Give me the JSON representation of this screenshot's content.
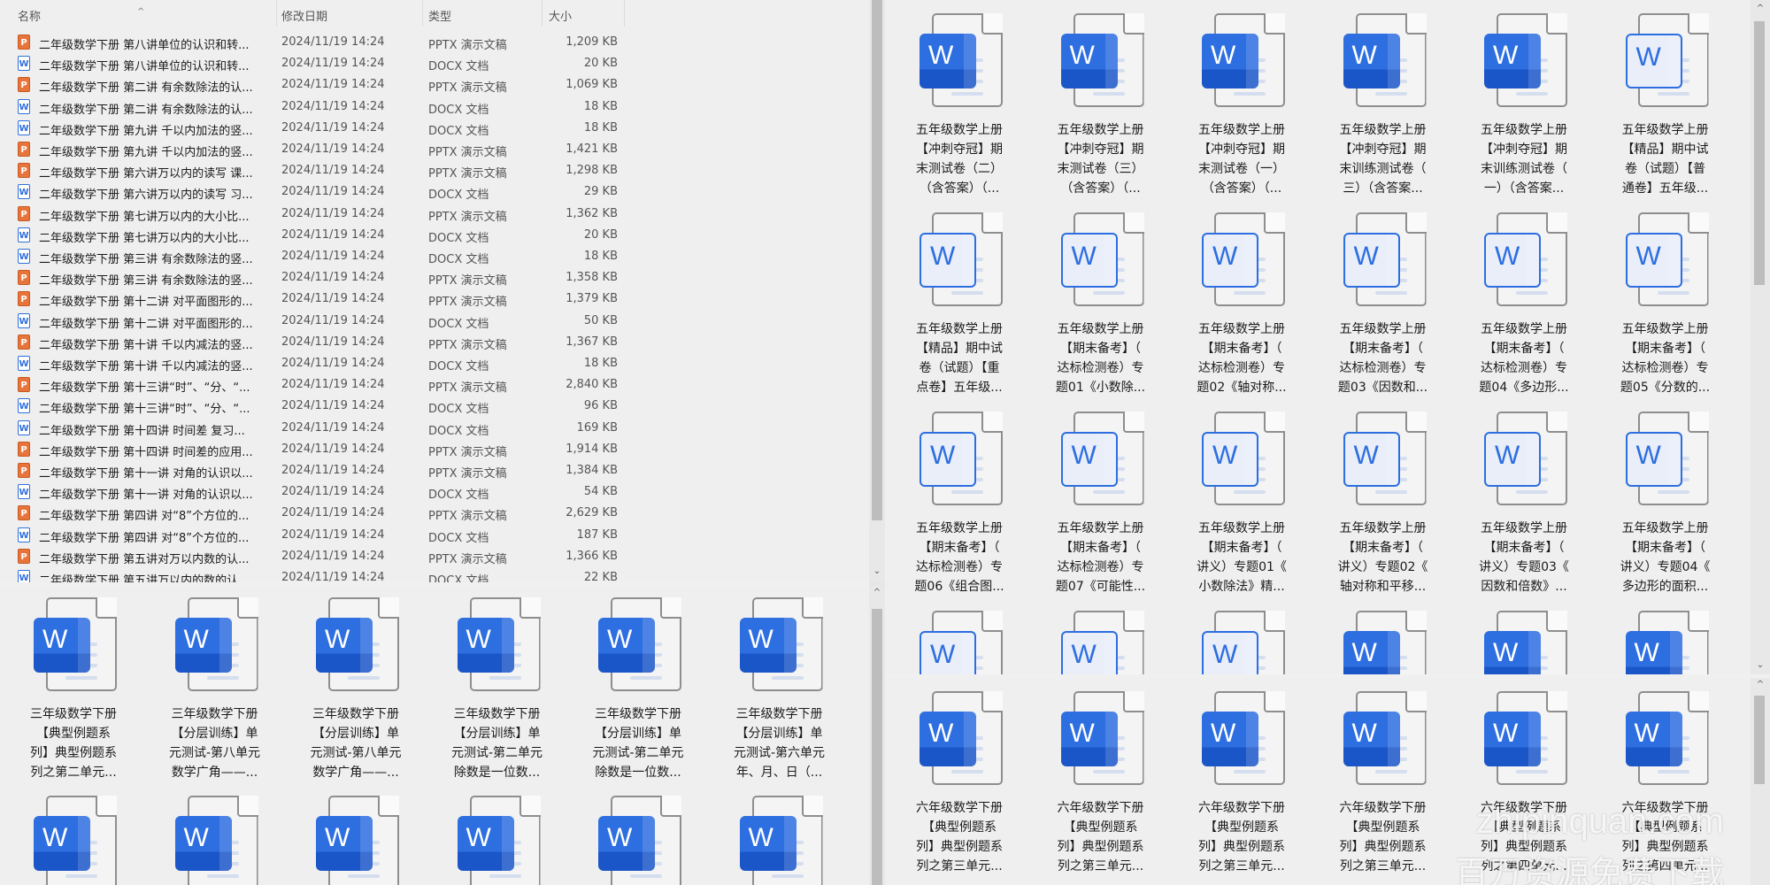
{
  "left_list": {
    "headers": {
      "name": "名称",
      "date": "修改日期",
      "type": "类型",
      "size": "大小"
    },
    "rows": [
      {
        "icon": "pptx",
        "name": "二年级数学下册  第八讲单位的认识和转...",
        "date": "2024/11/19 14:24",
        "type": "PPTX 演示文稿",
        "size": "1,209 KB"
      },
      {
        "icon": "docx",
        "name": "二年级数学下册  第八讲单位的认识和转...",
        "date": "2024/11/19 14:24",
        "type": "DOCX 文档",
        "size": "20 KB"
      },
      {
        "icon": "pptx",
        "name": "二年级数学下册  第二讲 有余数除法的认...",
        "date": "2024/11/19 14:24",
        "type": "PPTX 演示文稿",
        "size": "1,069 KB"
      },
      {
        "icon": "docx",
        "name": "二年级数学下册  第二讲 有余数除法的认...",
        "date": "2024/11/19 14:24",
        "type": "DOCX 文档",
        "size": "18 KB"
      },
      {
        "icon": "docx",
        "name": "二年级数学下册  第九讲 千以内加法的竖...",
        "date": "2024/11/19 14:24",
        "type": "DOCX 文档",
        "size": "18 KB"
      },
      {
        "icon": "pptx",
        "name": "二年级数学下册  第九讲 千以内加法的竖...",
        "date": "2024/11/19 14:24",
        "type": "PPTX 演示文稿",
        "size": "1,421 KB"
      },
      {
        "icon": "pptx",
        "name": "二年级数学下册  第六讲万以内的读写 课...",
        "date": "2024/11/19 14:24",
        "type": "PPTX 演示文稿",
        "size": "1,298 KB"
      },
      {
        "icon": "docx",
        "name": "二年级数学下册  第六讲万以内的读写 习...",
        "date": "2024/11/19 14:24",
        "type": "DOCX 文档",
        "size": "29 KB"
      },
      {
        "icon": "pptx",
        "name": "二年级数学下册  第七讲万以内的大小比...",
        "date": "2024/11/19 14:24",
        "type": "PPTX 演示文稿",
        "size": "1,362 KB"
      },
      {
        "icon": "docx",
        "name": "二年级数学下册  第七讲万以内的大小比...",
        "date": "2024/11/19 14:24",
        "type": "DOCX 文档",
        "size": "20 KB"
      },
      {
        "icon": "docx",
        "name": "二年级数学下册  第三讲 有余数除法的竖...",
        "date": "2024/11/19 14:24",
        "type": "DOCX 文档",
        "size": "18 KB"
      },
      {
        "icon": "pptx",
        "name": "二年级数学下册  第三讲 有余数除法的竖...",
        "date": "2024/11/19 14:24",
        "type": "PPTX 演示文稿",
        "size": "1,358 KB"
      },
      {
        "icon": "pptx",
        "name": "二年级数学下册  第十二讲 对平面图形的...",
        "date": "2024/11/19 14:24",
        "type": "PPTX 演示文稿",
        "size": "1,379 KB"
      },
      {
        "icon": "docx",
        "name": "二年级数学下册  第十二讲 对平面图形的...",
        "date": "2024/11/19 14:24",
        "type": "DOCX 文档",
        "size": "50 KB"
      },
      {
        "icon": "pptx",
        "name": "二年级数学下册  第十讲 千以内减法的竖...",
        "date": "2024/11/19 14:24",
        "type": "PPTX 演示文稿",
        "size": "1,367 KB"
      },
      {
        "icon": "docx",
        "name": "二年级数学下册  第十讲 千以内减法的竖...",
        "date": "2024/11/19 14:24",
        "type": "DOCX 文档",
        "size": "18 KB"
      },
      {
        "icon": "pptx",
        "name": "二年级数学下册  第十三讲“时”、“分、“...",
        "date": "2024/11/19 14:24",
        "type": "PPTX 演示文稿",
        "size": "2,840 KB"
      },
      {
        "icon": "docx",
        "name": "二年级数学下册  第十三讲“时”、“分、“...",
        "date": "2024/11/19 14:24",
        "type": "DOCX 文档",
        "size": "96 KB"
      },
      {
        "icon": "docx",
        "name": "二年级数学下册  第十四讲 时间差 复习...",
        "date": "2024/11/19 14:24",
        "type": "DOCX 文档",
        "size": "169 KB"
      },
      {
        "icon": "pptx",
        "name": "二年级数学下册  第十四讲 时间差的应用...",
        "date": "2024/11/19 14:24",
        "type": "PPTX 演示文稿",
        "size": "1,914 KB"
      },
      {
        "icon": "pptx",
        "name": "二年级数学下册  第十一讲 对角的认识以...",
        "date": "2024/11/19 14:24",
        "type": "PPTX 演示文稿",
        "size": "1,384 KB"
      },
      {
        "icon": "docx",
        "name": "二年级数学下册  第十一讲 对角的认识以...",
        "date": "2024/11/19 14:24",
        "type": "DOCX 文档",
        "size": "54 KB"
      },
      {
        "icon": "pptx",
        "name": "二年级数学下册  第四讲 对“8”个方位的...",
        "date": "2024/11/19 14:24",
        "type": "PPTX 演示文稿",
        "size": "2,629 KB"
      },
      {
        "icon": "docx",
        "name": "二年级数学下册  第四讲 对“8”个方位的...",
        "date": "2024/11/19 14:24",
        "type": "DOCX 文档",
        "size": "187 KB"
      },
      {
        "icon": "pptx",
        "name": "二年级数学下册  第五讲对万以内数的认...",
        "date": "2024/11/19 14:24",
        "type": "PPTX 演示文稿",
        "size": "1,366 KB"
      },
      {
        "icon": "docx",
        "name": "二年级数学下册  第五讲万以内的数的认...",
        "date": "2024/11/19 14:24",
        "type": "DOCX 文档",
        "size": "22 KB"
      }
    ]
  },
  "left_grid": {
    "items": [
      {
        "style": "solid",
        "lines": [
          "三年级数学下册",
          "【典型例题系",
          "列】典型例题系",
          "列之第二单元..."
        ]
      },
      {
        "style": "solid",
        "lines": [
          "三年级数学下册",
          "【分层训练】单",
          "元测试-第八单元",
          "数学广角——..."
        ]
      },
      {
        "style": "solid",
        "lines": [
          "三年级数学下册",
          "【分层训练】单",
          "元测试-第八单元",
          "数学广角——..."
        ]
      },
      {
        "style": "solid",
        "lines": [
          "三年级数学下册",
          "【分层训练】单",
          "元测试-第二单元",
          "除数是一位数..."
        ]
      },
      {
        "style": "solid",
        "lines": [
          "三年级数学下册",
          "【分层训练】单",
          "元测试-第二单元",
          "除数是一位数..."
        ]
      },
      {
        "style": "solid",
        "lines": [
          "三年级数学下册",
          "【分层训练】单",
          "元测试-第六单元",
          "年、月、日（..."
        ]
      },
      {
        "style": "solid",
        "lines": []
      },
      {
        "style": "solid",
        "lines": []
      },
      {
        "style": "solid",
        "lines": []
      },
      {
        "style": "solid",
        "lines": []
      },
      {
        "style": "solid",
        "lines": []
      },
      {
        "style": "solid",
        "lines": []
      }
    ]
  },
  "right_grid": {
    "items": [
      {
        "style": "solid",
        "lines": [
          "五年级数学上册",
          "【冲刺夺冠】期",
          "末测试卷（二）",
          "（含答案）（..."
        ]
      },
      {
        "style": "solid",
        "lines": [
          "五年级数学上册",
          "【冲刺夺冠】期",
          "末测试卷（三）",
          "（含答案）（..."
        ]
      },
      {
        "style": "solid",
        "lines": [
          "五年级数学上册",
          "【冲刺夺冠】期",
          "末测试卷（一）",
          "（含答案）（..."
        ]
      },
      {
        "style": "solid",
        "lines": [
          "五年级数学上册",
          "【冲刺夺冠】期",
          "末训练测试卷（",
          "三）（含答案..."
        ]
      },
      {
        "style": "solid",
        "lines": [
          "五年级数学上册",
          "【冲刺夺冠】期",
          "末训练测试卷（",
          "一）（含答案..."
        ]
      },
      {
        "style": "outline",
        "lines": [
          "五年级数学上册",
          "【精品】期中试",
          "卷（试题）【普",
          "通卷】五年级..."
        ]
      },
      {
        "style": "outline",
        "lines": [
          "五年级数学上册",
          "【精品】期中试",
          "卷（试题）【重",
          "点卷】五年级..."
        ]
      },
      {
        "style": "outline",
        "lines": [
          "五年级数学上册",
          "【期末备考】（",
          "达标检测卷）专",
          "题01《小数除..."
        ]
      },
      {
        "style": "outline",
        "lines": [
          "五年级数学上册",
          "【期末备考】（",
          "达标检测卷）专",
          "题02《轴对称..."
        ]
      },
      {
        "style": "outline",
        "lines": [
          "五年级数学上册",
          "【期末备考】（",
          "达标检测卷）专",
          "题03《因数和..."
        ]
      },
      {
        "style": "outline",
        "lines": [
          "五年级数学上册",
          "【期末备考】（",
          "达标检测卷）专",
          "题04《多边形..."
        ]
      },
      {
        "style": "outline",
        "lines": [
          "五年级数学上册",
          "【期末备考】（",
          "达标检测卷）专",
          "题05《分数的..."
        ]
      },
      {
        "style": "outline",
        "lines": [
          "五年级数学上册",
          "【期末备考】（",
          "达标检测卷）专",
          "题06《组合图..."
        ]
      },
      {
        "style": "outline",
        "lines": [
          "五年级数学上册",
          "【期末备考】（",
          "达标检测卷）专",
          "题07《可能性..."
        ]
      },
      {
        "style": "outline",
        "lines": [
          "五年级数学上册",
          "【期末备考】（",
          "讲义）专题01《",
          "小数除法》精..."
        ]
      },
      {
        "style": "outline",
        "lines": [
          "五年级数学上册",
          "【期末备考】（",
          "讲义）专题02《",
          "轴对称和平移..."
        ]
      },
      {
        "style": "outline",
        "lines": [
          "五年级数学上册",
          "【期末备考】（",
          "讲义）专题03《",
          "因数和倍数》..."
        ]
      },
      {
        "style": "outline",
        "lines": [
          "五年级数学上册",
          "【期末备考】（",
          "讲义）专题04《",
          "多边形的面积..."
        ]
      },
      {
        "style": "outline",
        "lines": []
      },
      {
        "style": "outline",
        "lines": []
      },
      {
        "style": "outline",
        "lines": []
      },
      {
        "style": "solid",
        "lines": []
      },
      {
        "style": "solid",
        "lines": []
      },
      {
        "style": "solid",
        "lines": []
      }
    ]
  },
  "right_grid_bottom": {
    "items": [
      {
        "style": "solid",
        "lines": [
          "六年级数学下册",
          "【典型例题系",
          "列】典型例题系",
          "列之第三单元..."
        ]
      },
      {
        "style": "solid",
        "lines": [
          "六年级数学下册",
          "【典型例题系",
          "列】典型例题系",
          "列之第三单元..."
        ]
      },
      {
        "style": "solid",
        "lines": [
          "六年级数学下册",
          "【典型例题系",
          "列】典型例题系",
          "列之第三单元..."
        ]
      },
      {
        "style": "solid",
        "lines": [
          "六年级数学下册",
          "【典型例题系",
          "列】典型例题系",
          "列之第三单元..."
        ]
      },
      {
        "style": "solid",
        "lines": [
          "六年级数学下册",
          "【典型例题系",
          "列】典型例题系",
          "列之第四单元..."
        ]
      },
      {
        "style": "solid",
        "lines": [
          "六年级数学下册",
          "【典型例题系",
          "列】典型例题系",
          "列之第四单元..."
        ]
      }
    ]
  },
  "watermark": {
    "line1": "zhipinquan.com",
    "line2": "百万资源免费下载"
  }
}
